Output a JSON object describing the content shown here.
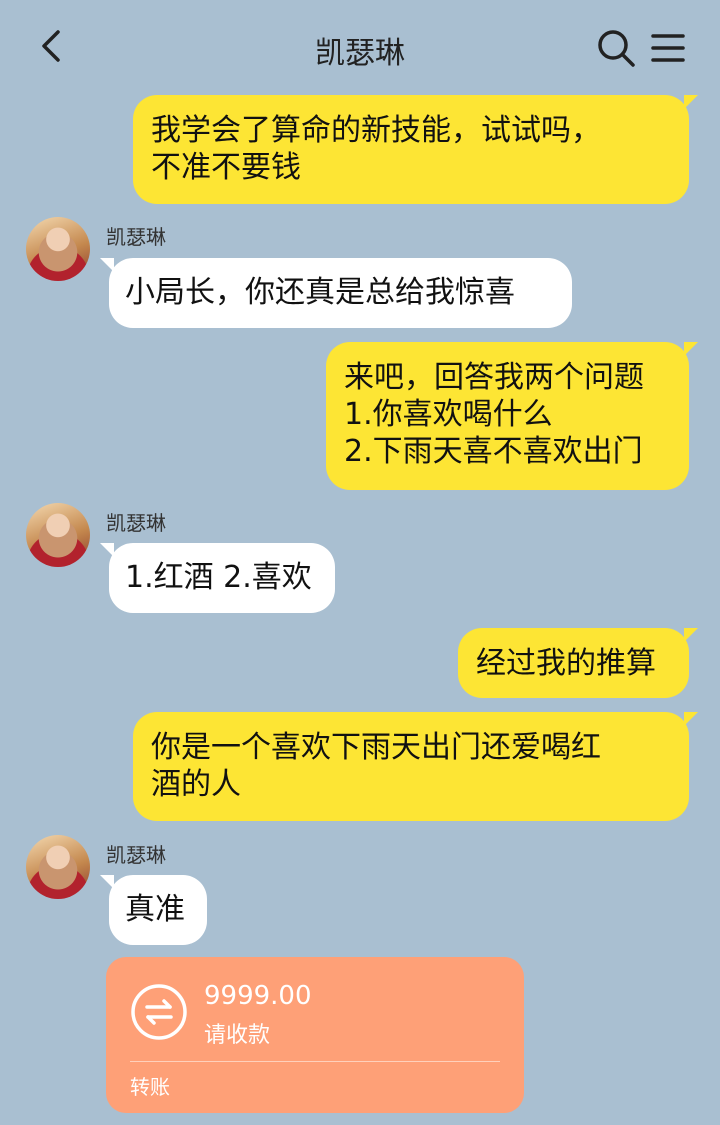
{
  "header": {
    "title": "凯瑟琳"
  },
  "messages": [
    {
      "side": "right",
      "lines": [
        "我学会了算命的新技能，试试吗，",
        "不准不要钱"
      ]
    },
    {
      "side": "left",
      "sender": "凯瑟琳",
      "lines": [
        "小局长，你还真是总给我惊喜"
      ]
    },
    {
      "side": "right",
      "lines": [
        "来吧，回答我两个问题",
        "1.你喜欢喝什么",
        "2.下雨天喜不喜欢出门"
      ]
    },
    {
      "side": "left",
      "sender": "凯瑟琳",
      "lines": [
        "1.红酒 2.喜欢"
      ]
    },
    {
      "side": "right",
      "lines": [
        "经过我的推算"
      ]
    },
    {
      "side": "right",
      "lines": [
        "你是一个喜欢下雨天出门还爱喝红",
        "酒的人"
      ]
    },
    {
      "side": "left",
      "sender": "凯瑟琳",
      "lines": [
        "真准"
      ]
    }
  ],
  "transfer": {
    "amount": "9999.00",
    "subtitle": "请收款",
    "type_label": "转账"
  },
  "icons": {
    "back": "chevron-left-icon",
    "search": "search-icon",
    "menu": "menu-icon",
    "transfer": "transfer-arrows-icon"
  },
  "colors": {
    "background": "#a9bfd1",
    "my_bubble": "#fde534",
    "their_bubble": "#ffffff",
    "transfer_card": "#fea077"
  }
}
